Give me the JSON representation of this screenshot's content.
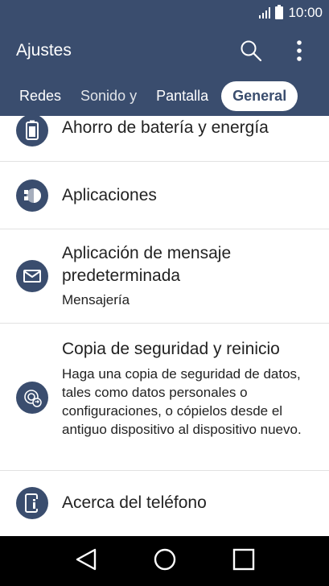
{
  "status_bar": {
    "time": "10:00"
  },
  "app_bar": {
    "title": "Ajustes"
  },
  "tabs": [
    {
      "label": "Redes"
    },
    {
      "label": "Sonido y"
    },
    {
      "label": "Pantalla"
    },
    {
      "label": "General"
    }
  ],
  "settings": [
    {
      "title": "Ahorro de batería y energía"
    },
    {
      "title": "Aplicaciones"
    },
    {
      "title": "Aplicación de mensaje predeterminada",
      "subtitle": "Mensajería"
    },
    {
      "title": "Copia de seguridad y reinicio",
      "subtitle": "Haga una copia de seguridad de datos, tales como datos personales o configuraciones, o cópielos desde el antiguo dispositivo al dispositivo nuevo."
    },
    {
      "title": "Acerca del teléfono"
    }
  ],
  "colors": {
    "primary": "#3a4d6e",
    "background": "#ffffff",
    "nav": "#000000"
  },
  "icons": [
    "signal-icon",
    "battery-icon",
    "search-icon",
    "more-vert-icon",
    "battery-saver-icon",
    "apps-icon",
    "message-icon",
    "backup-icon",
    "phone-info-icon",
    "back-icon",
    "home-icon",
    "recents-icon"
  ]
}
